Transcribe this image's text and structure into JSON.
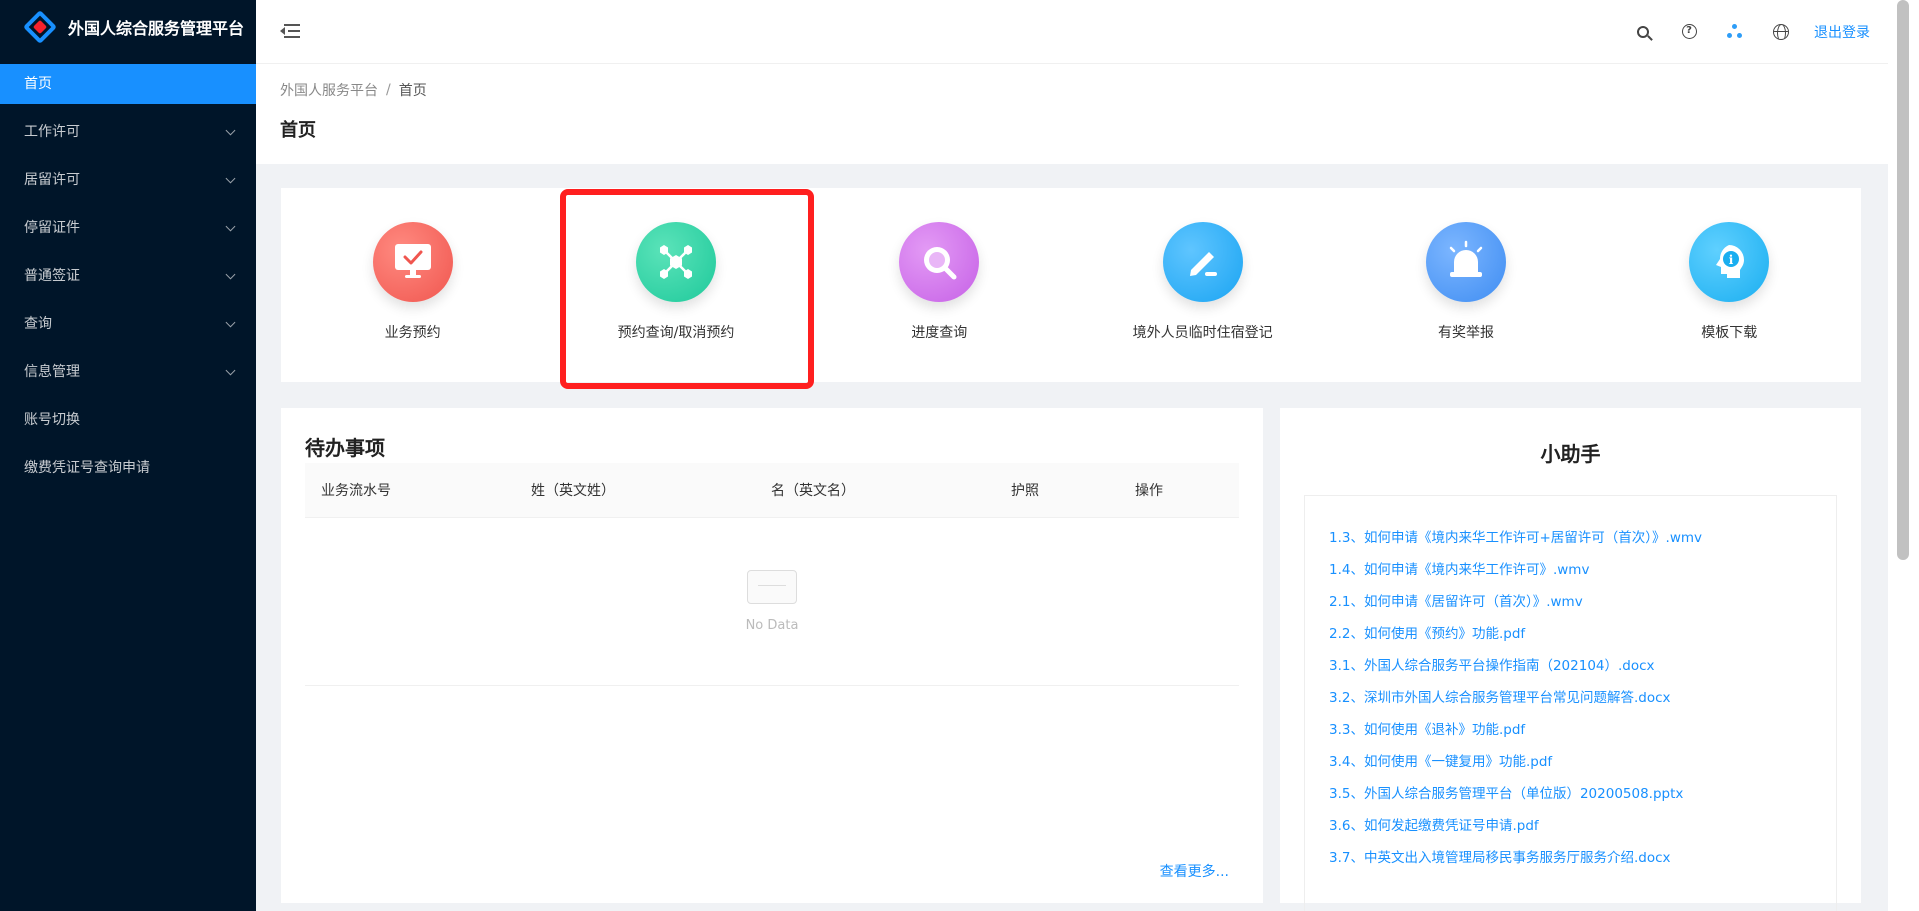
{
  "app": {
    "title": "外国人综合服务管理平台"
  },
  "sidebar": {
    "items": [
      {
        "label": "首页",
        "active": true,
        "has_children": false
      },
      {
        "label": "工作许可",
        "active": false,
        "has_children": true
      },
      {
        "label": "居留许可",
        "active": false,
        "has_children": true
      },
      {
        "label": "停留证件",
        "active": false,
        "has_children": true
      },
      {
        "label": "普通签证",
        "active": false,
        "has_children": true
      },
      {
        "label": "查询",
        "active": false,
        "has_children": true
      },
      {
        "label": "信息管理",
        "active": false,
        "has_children": true
      },
      {
        "label": "账号切换",
        "active": false,
        "has_children": false
      },
      {
        "label": "缴费凭证号查询申请",
        "active": false,
        "has_children": false
      }
    ]
  },
  "header": {
    "icons": [
      "search-icon",
      "help-icon",
      "apps-icon",
      "globe-icon"
    ],
    "logout_label": "退出登录"
  },
  "breadcrumb": {
    "root": "外国人服务平台",
    "separator": "/",
    "current": "首页"
  },
  "page": {
    "title": "首页"
  },
  "quick_actions": [
    {
      "label": "业务预约",
      "icon": "monitor-check-icon",
      "color": "#f0564f"
    },
    {
      "label": "预约查询/取消预约",
      "icon": "network-icon",
      "color": "#1ec99b"
    },
    {
      "label": "进度查询",
      "icon": "magnifier-icon",
      "color": "#c661e6"
    },
    {
      "label": "境外人员临时住宿登记",
      "icon": "pencil-icon",
      "color": "#1aa4f2"
    },
    {
      "label": "有奖举报",
      "icon": "alarm-icon",
      "color": "#3f8df2"
    },
    {
      "label": "模板下载",
      "icon": "info-head-icon",
      "color": "#1aaef0"
    }
  ],
  "todo": {
    "title": "待办事项",
    "columns": [
      "业务流水号",
      "姓（英文姓）",
      "名（英文名）",
      "护照",
      "操作"
    ],
    "rows": [],
    "empty_text": "No Data",
    "more_label": "查看更多..."
  },
  "helper": {
    "title": "小助手",
    "links": [
      "1.3、如何申请《境内来华工作许可+居留许可（首次）》.wmv",
      "1.4、如何申请《境内来华工作许可》.wmv",
      "2.1、如何申请《居留许可（首次）》.wmv",
      "2.2、如何使用《预约》功能.pdf",
      "3.1、外国人综合服务平台操作指南（202104）.docx",
      "3.2、深圳市外国人综合服务管理平台常见问题解答.docx",
      "3.3、如何使用《退补》功能.pdf",
      "3.4、如何使用《一键复用》功能.pdf",
      "3.5、外国人综合服务管理平台（单位版）20200508.pptx",
      "3.6、如何发起缴费凭证号申请.pdf",
      "3.7、中英文出入境管理局移民事务服务厅服务介绍.docx"
    ]
  }
}
